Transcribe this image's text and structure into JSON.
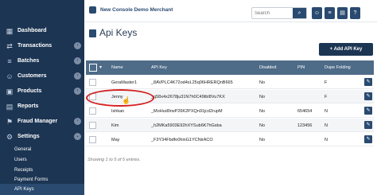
{
  "sidebar": {
    "items": [
      {
        "label": "Dashboard",
        "icon": "dashboard-icon",
        "glyph": "▦",
        "has_arrow": false
      },
      {
        "label": "Transactions",
        "icon": "transactions-icon",
        "glyph": "⇄",
        "has_arrow": true
      },
      {
        "label": "Batches",
        "icon": "batches-icon",
        "glyph": "≡",
        "has_arrow": true
      },
      {
        "label": "Customers",
        "icon": "customers-icon",
        "glyph": "☺",
        "has_arrow": true
      },
      {
        "label": "Products",
        "icon": "products-icon",
        "glyph": "▣",
        "has_arrow": true
      },
      {
        "label": "Reports",
        "icon": "reports-icon",
        "glyph": "▤",
        "has_arrow": false
      },
      {
        "label": "Fraud Manager",
        "icon": "fraud-manager-icon",
        "glyph": "⚑",
        "has_arrow": true
      },
      {
        "label": "Settings",
        "icon": "settings-icon",
        "glyph": "⚙",
        "has_arrow": true
      }
    ],
    "settings_sub": [
      {
        "label": "General"
      },
      {
        "label": "Users"
      },
      {
        "label": "Receipts"
      },
      {
        "label": "Payment Forms"
      },
      {
        "label": "API Keys",
        "active": true
      }
    ]
  },
  "header": {
    "merchant_name": "New Console Demo Merchant",
    "search_placeholder": "Search"
  },
  "page": {
    "title": "Api Keys",
    "add_button": "+ Add API Key"
  },
  "table": {
    "headers": {
      "name": "Name",
      "api_key": "API Key",
      "disabled": "Disabled",
      "pin": "PIN",
      "dupe_folding": "Dupe Folding"
    },
    "rows": [
      {
        "name": "GeraMaster1",
        "api_key": "_8AVPLC4K72od4xL25q06HRERQnB665",
        "disabled": "No",
        "pin": "",
        "dupe": "F"
      },
      {
        "name": "Jenny",
        "api_key": "_q58x4x2678ju31N7h0C49tbI8Vu7KX",
        "disabled": "No",
        "pin": "",
        "dupe": "F"
      },
      {
        "name": "Ishkan",
        "api_key": "_MoHud0rwP26K2PXQn91jcd2rupM",
        "disabled": "No",
        "pin": "654654",
        "dupe": "N"
      },
      {
        "name": "Kim",
        "api_key": "_h2MKa5903E92hXYSub6K7hGsba",
        "disabled": "No",
        "pin": "123456",
        "dupe": "N"
      },
      {
        "name": "May",
        "api_key": "_F3Y34Fbdfo0hinG1YCNirACO",
        "disabled": "No",
        "pin": "",
        "dupe": "N"
      }
    ],
    "footer": "Showing 1 to 5 of 5 entries."
  },
  "colors": {
    "sidebar": "#1c3553",
    "table_header": "#4e6b88",
    "annotation": "#d32020"
  }
}
